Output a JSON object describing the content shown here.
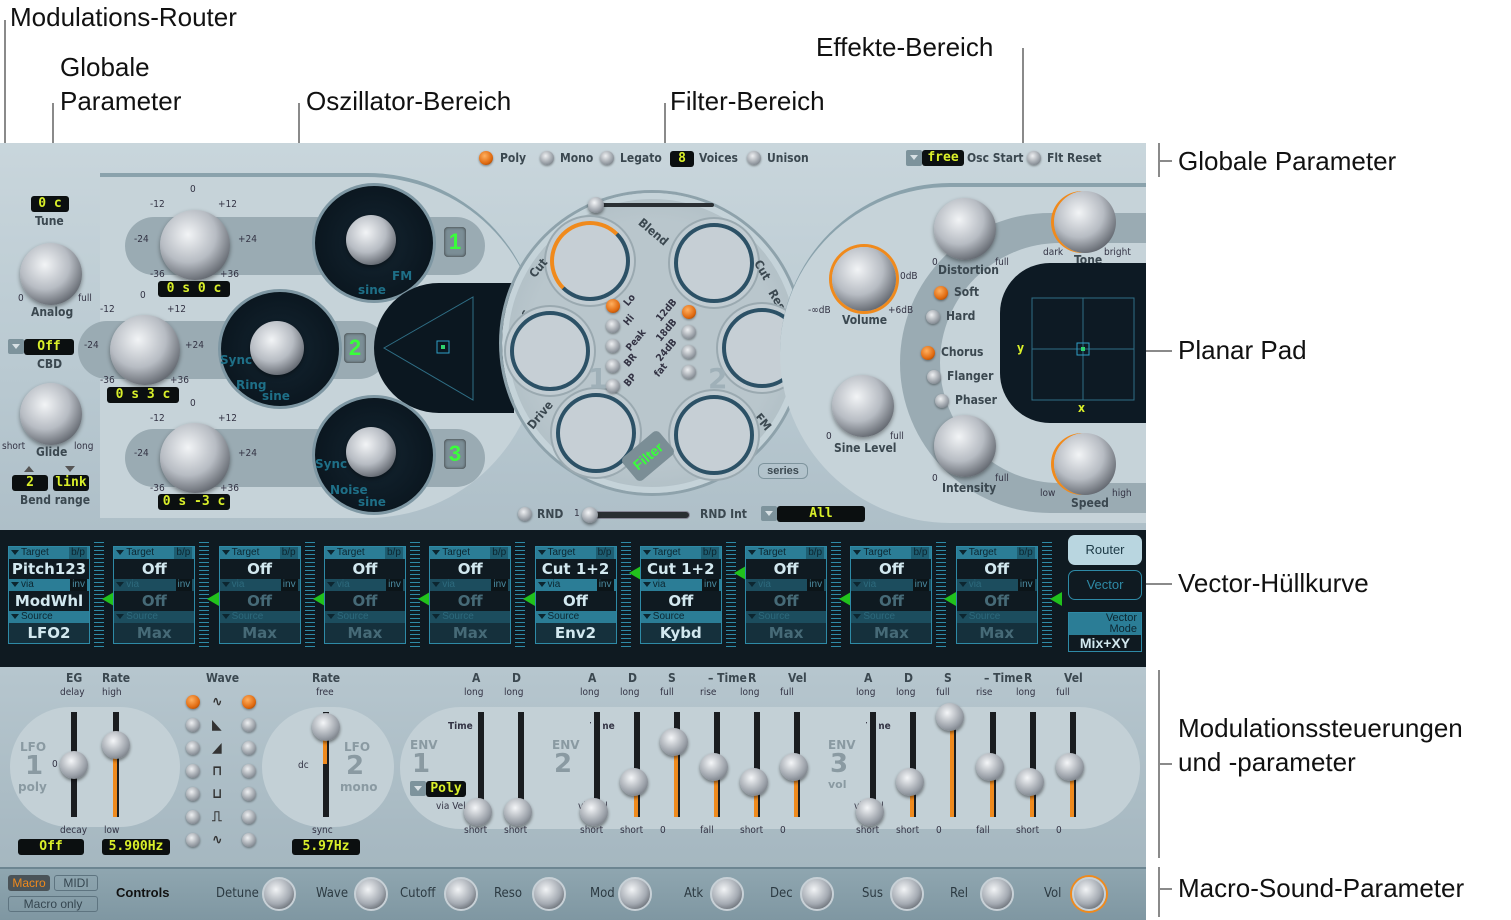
{
  "callouts": {
    "mod_router": "Modulations-Router",
    "global_params_left": [
      "Globale",
      "Parameter"
    ],
    "osc_area": "Oszillator-Bereich",
    "filter_area": "Filter-Bereich",
    "effects_area": "Effekte-Bereich",
    "global_params_right": "Globale Parameter",
    "planar_pad": "Planar Pad",
    "vector_envelope": "Vector-Hüllkurve",
    "mod_controls": [
      "Modulationssteuerungen",
      "und -parameter"
    ],
    "macro_params": "Macro-Sound-Parameter"
  },
  "global": {
    "tune_value": "0 c",
    "tune_label": "Tune",
    "analog_label": "Analog",
    "analog_min": "0",
    "analog_max": "full",
    "cbd_value": "Off",
    "cbd_label": "CBD",
    "glide_label": "Glide",
    "glide_min": "short",
    "glide_max": "long",
    "bend_up": "2",
    "bend_down": "link",
    "bend_label": "Bend range"
  },
  "voice": {
    "modes": [
      {
        "label": "Poly",
        "active": true
      },
      {
        "label": "Mono",
        "active": false
      },
      {
        "label": "Legato",
        "active": false
      }
    ],
    "voices_value": "8",
    "voices_label": "Voices",
    "unison_label": "Unison",
    "osc_start_value": "free",
    "osc_start_label": "Osc Start",
    "flt_reset_label": "Flt Reset"
  },
  "oscillators": [
    {
      "number": "1",
      "pitch_display": "0 s   0 c",
      "waves": [
        "sine",
        "FM"
      ],
      "ticks": [
        "-12",
        "0",
        "+12",
        "-24",
        "+24",
        "-36",
        "+36"
      ]
    },
    {
      "number": "2",
      "pitch_display": "0 s   3 c",
      "waves": [
        "Sync",
        "Ring",
        "sine"
      ],
      "ticks": [
        "-12",
        "0",
        "+12",
        "-24",
        "+24",
        "-36",
        "+36"
      ]
    },
    {
      "number": "3",
      "pitch_display": "0 s  -3 c",
      "waves": [
        "Sync",
        "Noise",
        "sine"
      ],
      "ticks": [
        "-12",
        "0",
        "+12",
        "-24",
        "+24",
        "-36",
        "+36"
      ]
    }
  ],
  "filter": {
    "blend_label": "Blend",
    "f1_labels": [
      "Cut",
      "Res",
      "Drive"
    ],
    "f2_labels": [
      "Cut",
      "Res",
      "FM"
    ],
    "f1_types": [
      {
        "label": "Lo",
        "active": true
      },
      {
        "label": "Hi",
        "active": false
      },
      {
        "label": "Peak",
        "active": false
      },
      {
        "label": "BR",
        "active": false
      },
      {
        "label": "BP",
        "active": false
      }
    ],
    "f2_slopes": [
      {
        "label": "12dB",
        "active": true
      },
      {
        "label": "18dB",
        "active": false
      },
      {
        "label": "24dB",
        "active": false
      },
      {
        "label": "fat",
        "active": false
      }
    ],
    "filter_button": "Filter",
    "series_button": "series",
    "num1": "1",
    "num2": "2"
  },
  "rnd": {
    "label": "RND",
    "slider_min": "1",
    "int_label": "RND Int",
    "target_value": "All"
  },
  "output": {
    "volume_label": "Volume",
    "vol_min": "-∞dB",
    "vol_mid": "0dB",
    "vol_max": "+6dB",
    "sine_label": "Sine Level",
    "sine_min": "0",
    "sine_max": "full"
  },
  "effects": {
    "distortion_label": "Distortion",
    "dist_min": "0",
    "dist_max": "full",
    "tone_label": "Tone",
    "tone_min": "dark",
    "tone_max": "bright",
    "dist_types": [
      {
        "label": "Soft",
        "active": true
      },
      {
        "label": "Hard",
        "active": false
      }
    ],
    "mod_types": [
      {
        "label": "Chorus",
        "active": true
      },
      {
        "label": "Flanger",
        "active": false
      },
      {
        "label": "Phaser",
        "active": false
      }
    ],
    "intensity_label": "Intensity",
    "int_min": "0",
    "int_max": "full",
    "speed_label": "Speed",
    "speed_min": "low",
    "speed_max": "high",
    "pad_x": "x",
    "pad_y": "y"
  },
  "router": {
    "target_hdr": "Target",
    "bp_hdr": "b/p",
    "via_hdr": "via",
    "inv_hdr": "inv",
    "source_hdr": "Source",
    "slots": [
      {
        "target": "Pitch123",
        "via": "ModWhl",
        "source": "LFO2",
        "active": true,
        "via_active": true
      },
      {
        "target": "Off",
        "via": "Off",
        "source": "Max",
        "active": false,
        "via_active": false
      },
      {
        "target": "Off",
        "via": "Off",
        "source": "Max",
        "active": false,
        "via_active": false
      },
      {
        "target": "Off",
        "via": "Off",
        "source": "Max",
        "active": false,
        "via_active": false
      },
      {
        "target": "Off",
        "via": "Off",
        "source": "Max",
        "active": false,
        "via_active": false
      },
      {
        "target": "Cut 1+2",
        "via": "Off",
        "source": "Env2",
        "active": true,
        "via_active": true
      },
      {
        "target": "Cut 1+2",
        "via": "Off",
        "source": "Kybd",
        "active": true,
        "via_active": true
      },
      {
        "target": "Off",
        "via": "Off",
        "source": "Max",
        "active": false,
        "via_active": false
      },
      {
        "target": "Off",
        "via": "Off",
        "source": "Max",
        "active": false,
        "via_active": false
      },
      {
        "target": "Off",
        "via": "Off",
        "source": "Max",
        "active": false,
        "via_active": false
      }
    ],
    "router_button": "Router",
    "vector_button": "Vector",
    "vector_mode_label": [
      "Vector",
      "Mode"
    ],
    "vector_mode_value": "Mix+XY"
  },
  "lfo": {
    "lfo1": {
      "title": "LFO",
      "num": "1",
      "mode": "poly",
      "eg_label": "EG",
      "eg_top": "delay",
      "eg_bottom": "decay",
      "rate_label": "Rate",
      "rate_top": "high",
      "rate_bottom": "low",
      "eg_value": "Off",
      "rate_value": "5.900Hz",
      "zero_mark": "0"
    },
    "wave_label": "Wave",
    "wave_left_active": 0,
    "wave_right_active": 0,
    "lfo2": {
      "title": "LFO",
      "num": "2",
      "mode": "mono",
      "rate_label": "Rate",
      "rate_top": "free",
      "rate_bottom": "sync",
      "dc_label": "dc",
      "rate_value": "5.97Hz"
    }
  },
  "envelopes": {
    "env1": {
      "title": "ENV",
      "num": "1",
      "time_label": "Time",
      "via_label": "via Vel",
      "mode_value": "Poly",
      "cols": [
        {
          "h": "A",
          "top": "long",
          "bot": "short",
          "level": 0.05
        },
        {
          "h": "D",
          "top": "long",
          "bot": "short",
          "level": 0.05
        }
      ]
    },
    "env2": {
      "title": "ENV",
      "num": "2",
      "time_label": "Time",
      "via_label": "via Vel",
      "cols": [
        {
          "h": "A",
          "top": "long",
          "bot": "short",
          "level": 0.05
        },
        {
          "h": "D",
          "top": "long",
          "bot": "short",
          "level": 0.35
        },
        {
          "h": "S",
          "top": "full",
          "bot": "0",
          "level": 0.75
        },
        {
          "h": "– Time",
          "top": "rise",
          "bot": "fall",
          "level": 0.5
        },
        {
          "h": "R",
          "top": "long",
          "bot": "short",
          "level": 0.35
        },
        {
          "h": "Vel",
          "top": "full",
          "bot": "0",
          "level": 0.5
        }
      ]
    },
    "env3": {
      "title": "ENV",
      "num": "3",
      "mode": "vol",
      "time_label": "Time",
      "via_label": "via Vel",
      "cols": [
        {
          "h": "A",
          "top": "long",
          "bot": "short",
          "level": 0.05
        },
        {
          "h": "D",
          "top": "long",
          "bot": "short",
          "level": 0.35
        },
        {
          "h": "S",
          "top": "full",
          "bot": "0",
          "level": 1.0
        },
        {
          "h": "– Time",
          "top": "rise",
          "bot": "fall",
          "level": 0.5
        },
        {
          "h": "R",
          "top": "long",
          "bot": "short",
          "level": 0.35
        },
        {
          "h": "Vel",
          "top": "full",
          "bot": "0",
          "level": 0.5
        }
      ]
    }
  },
  "macro": {
    "macro_btn": "Macro",
    "midi_btn": "MIDI",
    "macro_only_btn": "Macro only",
    "controls_label": "Controls",
    "knobs": [
      "Detune",
      "Wave",
      "Cutoff",
      "Reso",
      "Mod",
      "Atk",
      "Dec",
      "Sus",
      "Rel",
      "Vol"
    ]
  },
  "colors": {
    "accent_orange": "#f08a1c",
    "lcd_text": "#d9ef2a",
    "osc_green": "#39ff3a",
    "router_blue": "#2e8aa6"
  }
}
